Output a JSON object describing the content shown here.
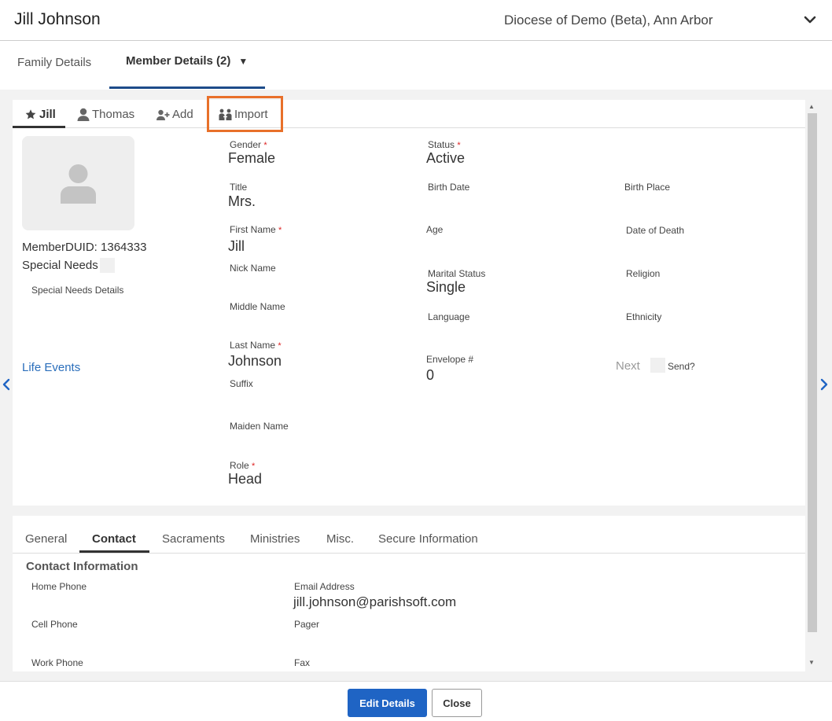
{
  "header": {
    "title": "Jill Johnson",
    "org": "Diocese of Demo (Beta), Ann Arbor"
  },
  "top_tabs": {
    "family": "Family Details",
    "member": "Member Details (2)",
    "member_caret": "▼"
  },
  "member_tabs": {
    "jill": "Jill",
    "thomas": "Thomas",
    "add": "Add",
    "import": "Import"
  },
  "profile": {
    "member_duid": "MemberDUID: 1364333",
    "special_needs": "Special Needs",
    "special_needs_details": "Special Needs Details",
    "life_events": "Life Events"
  },
  "fields": {
    "gender": {
      "label": "Gender",
      "value": "Female"
    },
    "status": {
      "label": "Status",
      "value": "Active"
    },
    "title": {
      "label": "Title",
      "value": "Mrs."
    },
    "birth_date": {
      "label": "Birth Date"
    },
    "birth_place": {
      "label": "Birth Place"
    },
    "first_name": {
      "label": "First Name",
      "value": "Jill"
    },
    "age": {
      "label": "Age"
    },
    "date_of_death": {
      "label": "Date of Death"
    },
    "nick_name": {
      "label": "Nick Name"
    },
    "marital_status": {
      "label": "Marital Status",
      "value": "Single"
    },
    "religion": {
      "label": "Religion"
    },
    "middle_name": {
      "label": "Middle Name"
    },
    "language": {
      "label": "Language"
    },
    "ethnicity": {
      "label": "Ethnicity"
    },
    "last_name": {
      "label": "Last Name",
      "value": "Johnson"
    },
    "envelope": {
      "label": "Envelope #",
      "value": "0"
    },
    "suffix": {
      "label": "Suffix"
    },
    "maiden_name": {
      "label": "Maiden Name"
    },
    "role": {
      "label": "Role",
      "value": "Head"
    },
    "required_mark": "*"
  },
  "envelope_extra": {
    "next": "Next",
    "send": "Send?"
  },
  "bottom_tabs": [
    "General",
    "Contact",
    "Sacraments",
    "Ministries",
    "Misc.",
    "Secure Information"
  ],
  "contact": {
    "section_title": "Contact Information",
    "home_phone": "Home Phone",
    "email_label": "Email Address",
    "email_value": "jill.johnson@parishsoft.com",
    "cell_phone": "Cell Phone",
    "pager": "Pager",
    "work_phone": "Work Phone",
    "fax": "Fax"
  },
  "footer": {
    "edit": "Edit Details",
    "close": "Close"
  },
  "colors": {
    "primary": "#1f64c4",
    "link": "#2a6ebb",
    "highlight": "#e8702a",
    "required": "#dd2222"
  }
}
